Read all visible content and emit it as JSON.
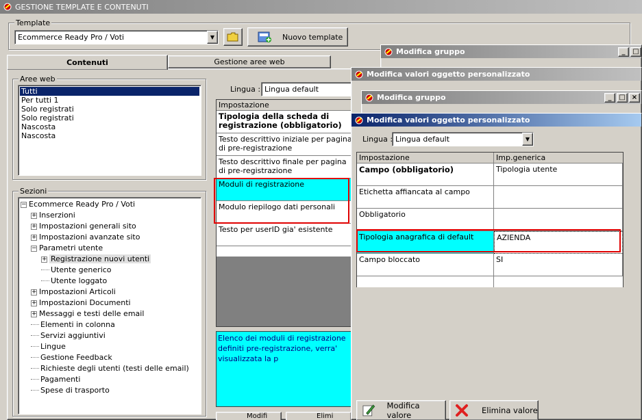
{
  "main_window": {
    "title": "GESTIONE TEMPLATE E CONTENUTI"
  },
  "template_group": {
    "label": "Template",
    "selected": "Ecommerce Ready Pro / Voti",
    "new_button": "Nuovo template"
  },
  "tabs": [
    {
      "label": "Contenuti"
    },
    {
      "label": "Gestione aree web"
    }
  ],
  "aree_web": {
    "label": "Aree web",
    "items": [
      "Tutti",
      "Per tutti 1",
      "Solo registrati",
      "Solo registrati",
      "Nascosta",
      "Nascosta"
    ]
  },
  "sezioni": {
    "label": "Sezioni",
    "tree": [
      {
        "label": "Ecommerce Ready Pro / Voti",
        "expander": "−"
      },
      {
        "label": "Inserzioni",
        "expander": "+"
      },
      {
        "label": "Impostazioni generali sito",
        "expander": "+"
      },
      {
        "label": "Impostazioni avanzate sito",
        "expander": "+"
      },
      {
        "label": "Parametri utente",
        "expander": "−"
      },
      {
        "label": "Registrazione nuovi utenti",
        "expander": "+"
      },
      {
        "label": "Utente generico",
        "expander": ""
      },
      {
        "label": "Utente loggato",
        "expander": ""
      },
      {
        "label": "Impostazioni Articoli",
        "expander": "+"
      },
      {
        "label": "Impostazioni Documenti",
        "expander": "+"
      },
      {
        "label": "Messaggi e testi delle email",
        "expander": "+"
      },
      {
        "label": "Elementi in colonna",
        "expander": ""
      },
      {
        "label": "Servizi aggiuntivi",
        "expander": ""
      },
      {
        "label": "Lingue",
        "expander": ""
      },
      {
        "label": "Gestione Feedback",
        "expander": ""
      },
      {
        "label": "Richieste degli utenti (testi delle email)",
        "expander": ""
      },
      {
        "label": "Pagamenti",
        "expander": ""
      },
      {
        "label": "Spese di trasporto",
        "expander": ""
      }
    ]
  },
  "content_panel": {
    "lingua_label": "Lingua :",
    "lingua_value": "Lingua default",
    "grid_header": "Impostazione",
    "rows": [
      "Tipologia della scheda di registrazione (obbligatorio)",
      "Testo descrittivo iniziale per pagina di pre-registrazione",
      "Testo descrittivo finale per pagina di pre-registrazione",
      "Moduli di registrazione",
      "Modulo riepilogo dati personali",
      "Testo per userID gia' esistente"
    ],
    "description": "Elenco dei moduli di registrazione definiti pre-registrazione, verra' visualizzata la p",
    "btn_modify": "Modifi",
    "btn_delete": "Elimi"
  },
  "win_group1": {
    "title": "Modifica gruppo"
  },
  "win_values1": {
    "title": "Modifica valori oggetto personalizzato"
  },
  "win_group2": {
    "title": "Modifica gruppo"
  },
  "win_values2": {
    "title": "Modifica valori oggetto personalizzato",
    "lingua_label": "Lingua :",
    "lingua_value": "Lingua default",
    "headers": [
      "Impostazione",
      "Imp.generica"
    ],
    "rows": [
      {
        "name": "Campo (obbligatorio)",
        "value": "Tipologia utente"
      },
      {
        "name": "Etichetta affiancata al campo",
        "value": ""
      },
      {
        "name": "Obbligatorio",
        "value": ""
      },
      {
        "name": "Tipologia anagrafica di default",
        "value": "AZIENDA"
      },
      {
        "name": "Campo bloccato",
        "value": "SI"
      }
    ],
    "btn_modify": "Modifica valore",
    "btn_delete": "Elimina valore"
  },
  "colors": {
    "cyan": "#00ffff",
    "red_highlight": "#e00000",
    "selection": "#0a246a",
    "description_bg": "#00ffff"
  }
}
